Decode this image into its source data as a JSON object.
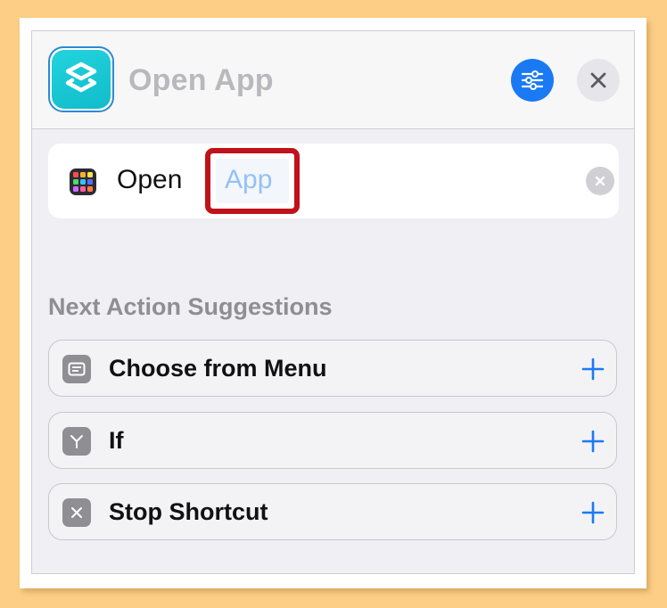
{
  "header": {
    "title": "Open App",
    "app_icon": "shortcuts-icon",
    "settings_icon": "sliders-icon",
    "close_icon": "close-icon"
  },
  "action": {
    "verb": "Open",
    "parameter_placeholder": "App",
    "icon": "app-grid-icon",
    "clear_icon": "clear-icon"
  },
  "suggestions": {
    "title": "Next Action Suggestions",
    "items": [
      {
        "label": "Choose from Menu",
        "icon": "menu-icon"
      },
      {
        "label": "If",
        "icon": "branch-icon"
      },
      {
        "label": "Stop Shortcut",
        "icon": "stop-x-icon"
      }
    ],
    "add_icon": "plus-icon"
  },
  "colors": {
    "accent": "#1a7af4",
    "highlight": "#c0121a",
    "background": "#fdcf86",
    "app_icon": "#19c6d4"
  }
}
